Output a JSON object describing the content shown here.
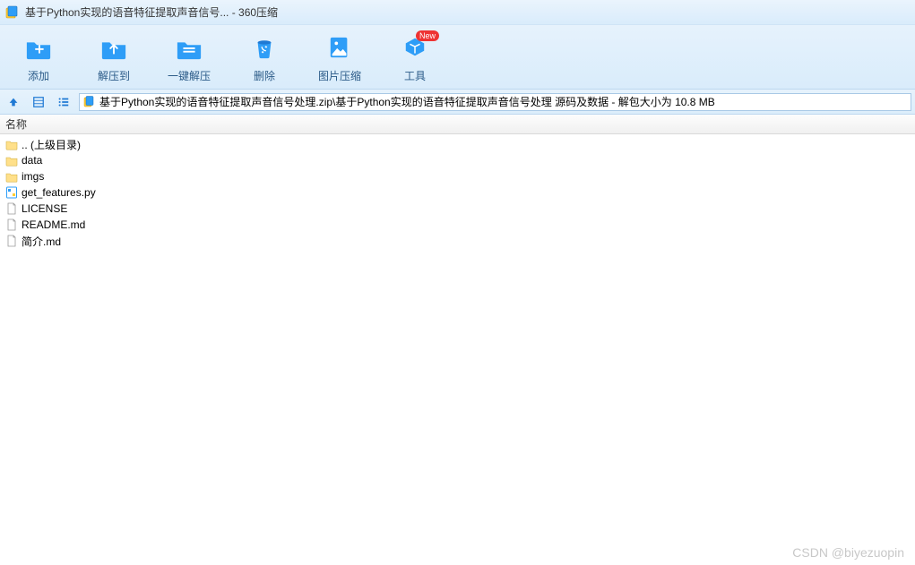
{
  "window": {
    "title": "基于Python实现的语音特征提取声音信号... - 360压缩"
  },
  "toolbar": {
    "add": {
      "label": "添加"
    },
    "extract": {
      "label": "解压到"
    },
    "oneclick": {
      "label": "一键解压"
    },
    "delete": {
      "label": "删除"
    },
    "imgzip": {
      "label": "图片压缩"
    },
    "tools": {
      "label": "工具",
      "badge": "New"
    }
  },
  "path": {
    "text": "基于Python实现的语音特征提取声音信号处理.zip\\基于Python实现的语音特征提取声音信号处理 源码及数据 - 解包大小为 10.8 MB"
  },
  "columns": {
    "name": "名称"
  },
  "files": [
    {
      "name": ".. (上级目录)",
      "icon": "folder-up"
    },
    {
      "name": "data",
      "icon": "folder"
    },
    {
      "name": "imgs",
      "icon": "folder"
    },
    {
      "name": "get_features.py",
      "icon": "py"
    },
    {
      "name": "LICENSE",
      "icon": "file"
    },
    {
      "name": "README.md",
      "icon": "file"
    },
    {
      "name": "简介.md",
      "icon": "file"
    }
  ],
  "watermark": "CSDN @biyezuopin"
}
